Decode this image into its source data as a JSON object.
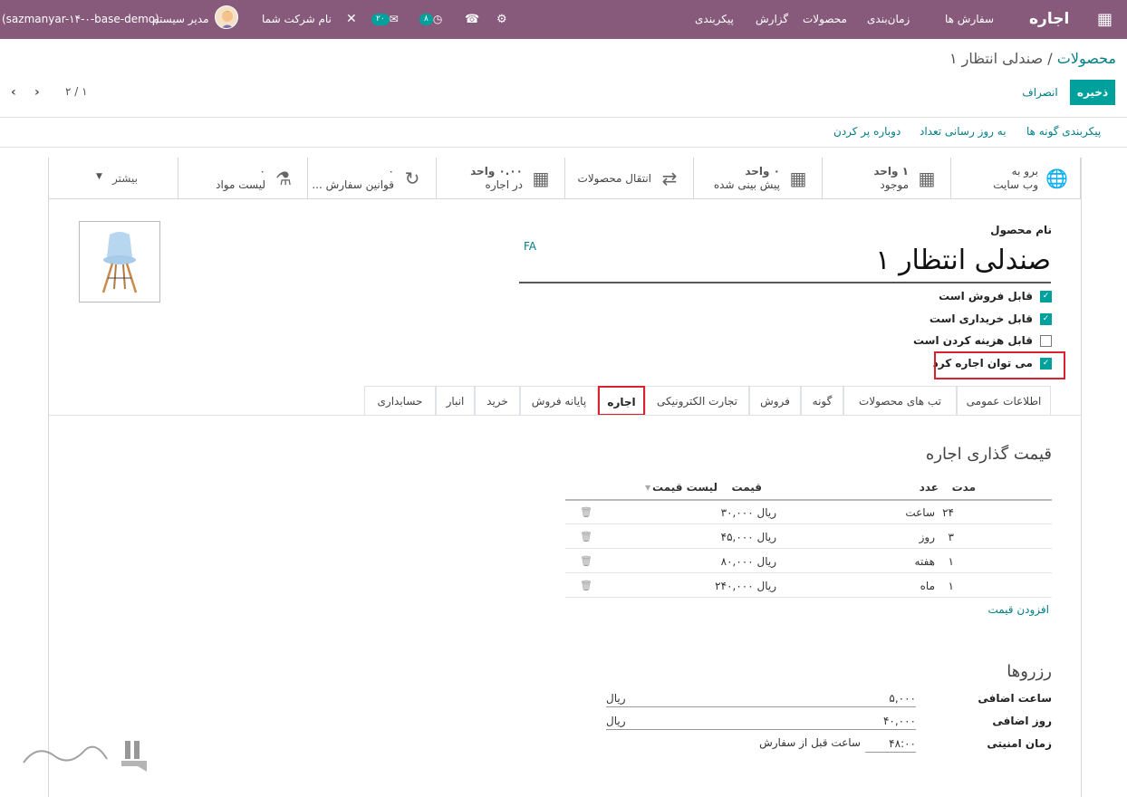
{
  "navbar": {
    "app_title": "اجاره",
    "menu": [
      "سفارش ها",
      "زمان‌بندی",
      "محصولات",
      "گزارش",
      "پیکربندی"
    ],
    "activity_count": "۸",
    "message_count": "۲۰",
    "company": "نام شرکت شما",
    "user": "مدیر سیستم",
    "database": "(sazmanyar-۱۴-۰-base-demo)"
  },
  "breadcrumb": {
    "parent": "محصولات",
    "separator": "/",
    "current": "صندلی انتظار ۱"
  },
  "buttons": {
    "save": "ذخیره",
    "discard": "انصراف"
  },
  "pager": {
    "value": "۲ / ۱"
  },
  "actions": [
    "پیکربندی گونه ها",
    "به روز رسانی تعداد",
    "دوباره پر کردن"
  ],
  "smart_buttons": {
    "website": {
      "line1": "برو به",
      "line2": "وب سایت"
    },
    "onhand": {
      "line1": "۱ واحد",
      "line2": "موجود"
    },
    "forecast": {
      "line1": "۰ واحد",
      "line2": "پیش بینی شده"
    },
    "moves": {
      "line1": "انتقال محصولات"
    },
    "rental": {
      "line1": "۰.۰۰ واحد",
      "line2": "در اجاره"
    },
    "reorder": {
      "line1": "۰",
      "line2": "قوانین سفارش ..."
    },
    "bom": {
      "line1": "۰",
      "line2": "لیست مواد"
    },
    "more": "بیشتر"
  },
  "product": {
    "name_label": "نام محصول",
    "name": "صندلی انتظار ۱",
    "lang": "FA",
    "checks": [
      {
        "label": "قابل فروش است",
        "checked": true
      },
      {
        "label": "قابل خریداری است",
        "checked": true
      },
      {
        "label": "قابل هزینه کردن است",
        "checked": false
      },
      {
        "label": "می توان اجاره کرد",
        "checked": true
      }
    ]
  },
  "tabs": [
    "اطلاعات عمومی",
    "تب های محصولات",
    "گونه",
    "فروش",
    "تجارت الکترونیکی",
    "اجاره",
    "پایانه فروش",
    "خرید",
    "انبار",
    "حسابداری"
  ],
  "pricing": {
    "title": "قیمت گذاری اجاره",
    "headers": {
      "duration": "مدت",
      "unit": "عدد",
      "price": "قیمت",
      "pricelist": "لیست قیمت"
    },
    "rows": [
      {
        "duration": "۲۴",
        "unit": "ساعت",
        "price": "۳۰,۰۰۰ ریال"
      },
      {
        "duration": "۳",
        "unit": "روز",
        "price": "۴۵,۰۰۰ ریال"
      },
      {
        "duration": "۱",
        "unit": "هفته",
        "price": "۸۰,۰۰۰ ریال"
      },
      {
        "duration": "۱",
        "unit": "ماه",
        "price": "۲۴۰,۰۰۰ ریال"
      }
    ],
    "add": "افزودن قیمت"
  },
  "reservations": {
    "title": "رزروها",
    "extra_hour_label": "ساعت اضافی",
    "extra_hour": "۵,۰۰۰",
    "extra_hour_cur": "ریال",
    "extra_day_label": "روز اضافی",
    "extra_day": "۴۰,۰۰۰",
    "extra_day_cur": "ریال",
    "security_label": "زمان امنیتی",
    "security": "۴۸:۰۰",
    "security_suffix": "ساعت قبل از سفارش"
  },
  "colors": {
    "navbar": "#875a7b",
    "accent": "#00a09d",
    "link": "#017e84",
    "highlight": "#d9232e"
  }
}
